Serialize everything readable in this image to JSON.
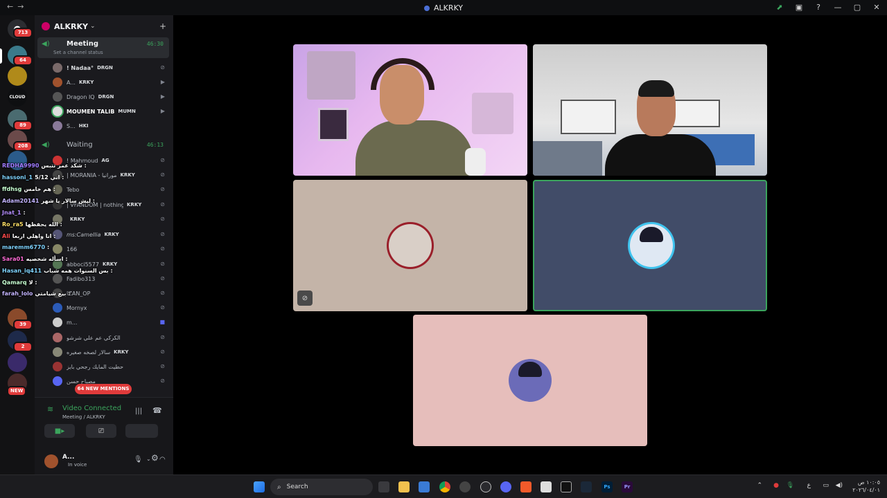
{
  "window": {
    "title": "ALKRKY"
  },
  "rail": {
    "badges": {
      "dm": "713",
      "s1": "64",
      "s2": "89",
      "s3": "208",
      "s4": "39",
      "s5": "2"
    },
    "new_label": "NEW"
  },
  "server": {
    "name": "ALKRKY"
  },
  "meeting": {
    "name": "Meeting",
    "timer": "46:30",
    "status": "Set a channel status",
    "members": [
      {
        "name": "! Nadaa°",
        "tag": "DRGN"
      },
      {
        "name": "A...",
        "tag": "KRKY"
      },
      {
        "name": "Dragon IQ",
        "tag": "DRGN"
      },
      {
        "name": "MOUMEN TALIB",
        "tag": "MUMN"
      },
      {
        "name": "S...",
        "tag": "HKI"
      }
    ]
  },
  "waiting": {
    "name": "Waiting",
    "timer": "46:13",
    "members": [
      {
        "name": "! Mahmoud",
        "tag": "AG"
      },
      {
        "name": "| MORANIA - مورانيا",
        "tag": "KRKY"
      },
      {
        "name": "Tebo",
        "tag": ""
      },
      {
        "name": "| VFANDOM | nothing |",
        "tag": "KRKY"
      },
      {
        "name": "",
        "tag": "KRKY"
      },
      {
        "name": "ms:Camellia",
        "tag": "KRKY"
      },
      {
        "name": "166",
        "tag": ""
      },
      {
        "name": "abboci5577",
        "tag": "KRKY"
      },
      {
        "name": "Fadibo313",
        "tag": ""
      },
      {
        "name": "IZAN_OP",
        "tag": ""
      },
      {
        "name": "Mornyx",
        "tag": ""
      },
      {
        "name": "m...",
        "tag": ""
      },
      {
        "name": "الكركي عم علي شرشو",
        "tag": ""
      },
      {
        "name": "سالار لصخه صغيره",
        "tag": "KRKY"
      },
      {
        "name": "بموكر حطيت المايك رجحي بايز",
        "tag": ""
      },
      {
        "name": "مصباح حسن",
        "tag": ""
      }
    ]
  },
  "chat": [
    {
      "user": "REDHA9990",
      "msg": "شكد عمر تتبس :"
    },
    {
      "user": "hassoni_1",
      "msg": "اني 5/12 :"
    },
    {
      "user": "ffdhsg",
      "msg": "هم خامس :"
    },
    {
      "user": "Adam20141",
      "msg": "ليش سالار يا شهر :"
    },
    {
      "user": "Jnat_1",
      "msg": ":"
    },
    {
      "user": "Ro_ra5",
      "msg": "الله يحفظها :"
    },
    {
      "user": "Ali",
      "msg": "انا واهلي اربعا :"
    },
    {
      "user": "maremm6770",
      "msg": ":"
    },
    {
      "user": "Sara01",
      "msg": "اسأله شخصيه :"
    },
    {
      "user": "Hasan_iq411",
      "msg": "بس السنوات همه شباب :"
    },
    {
      "user": "Qamarq",
      "msg": "لا :"
    },
    {
      "user": "farah_lolo",
      "msg": "بيع شيامتي :"
    }
  ],
  "new_mentions": "64 NEW MENTIONS",
  "voice": {
    "status": "Video Connected",
    "location": "Meeting / ALKRKY"
  },
  "user": {
    "name": "A...",
    "status": "In voice"
  },
  "taskbar": {
    "search_placeholder": "Search",
    "time": "١٠:٠٥ ص",
    "date": "٢٠٢٦/٠٤/٠١",
    "lang": "ع"
  },
  "colors": {
    "speaking": "#3ba55d",
    "mention": "#e03b3b",
    "tile1": "#c4b4a8",
    "tile2": "#414c68",
    "tile3": "#e6bebb"
  }
}
